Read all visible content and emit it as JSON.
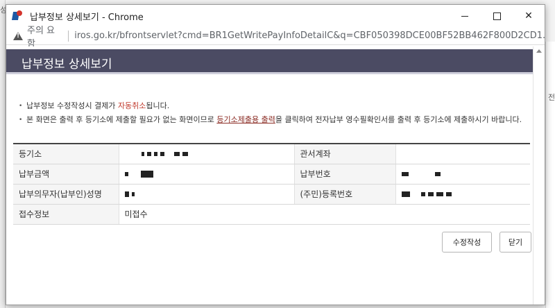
{
  "window": {
    "title": "납부정보 상세보기 - Chrome",
    "security_label": "주의 요함",
    "url": "iros.go.kr/bfrontservlet?cmd=BR1GetWritePayInfoDetailC&q=CBF050398DCE00BF52BB462F800D2CD1..."
  },
  "page": {
    "header_title": "납부정보 상세보기",
    "notes": {
      "n1_pre": "납부정보 수정작성시 결제가 ",
      "n1_red": "자동취소",
      "n1_post": "됩니다.",
      "n2_pre": "본 화면은 출력 후 등기소에 제출할 필요가 없는 화면이므로 ",
      "n2_link": "등기소제출용 출력",
      "n2_post": "을 클릭하여 전자납부 영수필확인서를 출력 후 등기소에 제출하시기 바랍니다."
    },
    "table": {
      "row1": {
        "label": "등기소",
        "label2": "관서계좌",
        "value2": ""
      },
      "row2": {
        "label": "납부금액",
        "label2": "납부번호"
      },
      "row3": {
        "label": "납부의무자(납부인)성명",
        "label2": "(주민)등록번호"
      },
      "row4": {
        "label": "접수정보",
        "value": "미접수"
      }
    },
    "buttons": {
      "edit": "수정작성",
      "close": "닫기"
    }
  },
  "background": {
    "left_char": "성",
    "right_char": "전"
  }
}
